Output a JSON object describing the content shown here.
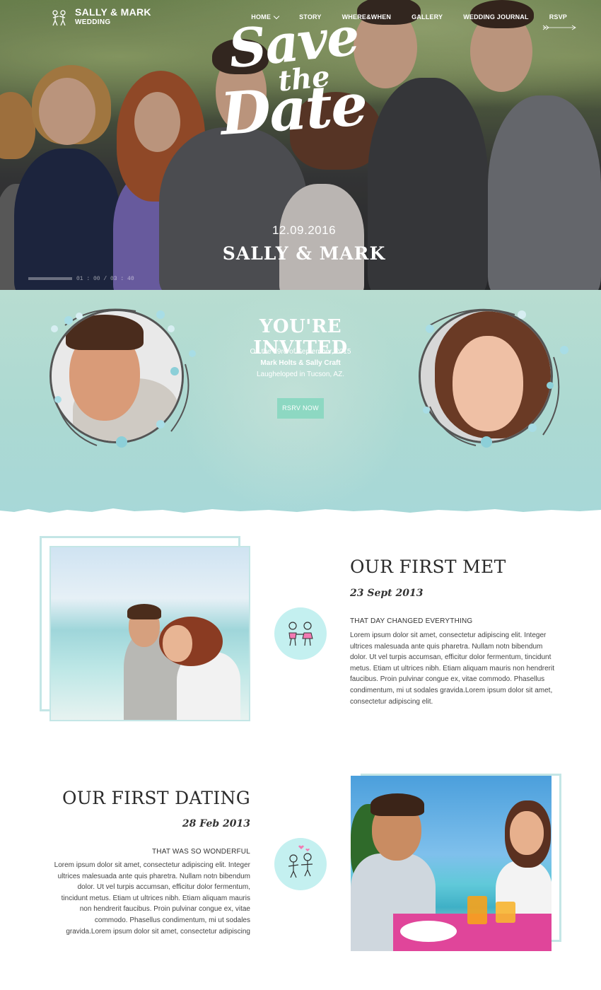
{
  "nav": {
    "brand_title": "SALLY & MARK",
    "brand_sub": "WEDDING",
    "items": [
      {
        "label": "HOME",
        "has_dropdown": true
      },
      {
        "label": "STORY"
      },
      {
        "label": "WHERE&WHEN"
      },
      {
        "label": "GALLERY"
      },
      {
        "label": "WEDDING JOURNAL"
      },
      {
        "label": "RSVP"
      }
    ]
  },
  "hero": {
    "script_line1": "Save",
    "script_line2": "the",
    "script_line3": "Date",
    "date": "12.09.2016",
    "names": "SALLY & MARK",
    "video_time": "01 : 00 / 03 : 40"
  },
  "invite": {
    "title": "YOU'RE INVITED",
    "line1": "On the 19rd of September, 2015",
    "line2": "Mark Holts & Sally Craft",
    "line3": "Laugheloped in Tucson, AZ.",
    "button": "RSRV NOW"
  },
  "story": [
    {
      "title": "OUR FIRST MET",
      "date": "23 Sept 2013",
      "subtitle": "THAT DAY CHANGED EVERYTHING",
      "body": "Lorem ipsum dolor sit amet, consectetur adipiscing elit. Integer ultrices malesuada ante quis pharetra. Nullam notn bibendum dolor. Ut vel turpis accumsan, efficitur dolor fermentum, tincidunt metus. Etiam ut ultrices nibh. Etiam aliquam mauris non hendrerit faucibus. Proin pulvinar congue ex, vitae commodo. Phasellus condimentum, mi ut sodales gravida.Lorem ipsum dolor sit amet, consectetur adipiscing elit.",
      "icon": "couple-holding-hands-icon"
    },
    {
      "title": "OUR FIRST DATING",
      "date": "28 Feb 2013",
      "subtitle": "THAT WAS SO WONDERFUL",
      "body": "Lorem ipsum dolor sit amet, consectetur adipiscing elit. Integer ultrices malesuada ante quis pharetra. Nullam notn bibendum dolor. Ut vel turpis accumsan, efficitur dolor fermentum, tincidunt metus. Etiam ut ultrices nibh. Etiam aliquam mauris non hendrerit faucibus. Proin pulvinar congue ex, vitae commodo. Phasellus condimentum, mi ut sodales gravida.Lorem ipsum dolor sit amet, consectetur adipiscing",
      "icon": "couple-with-hearts-icon"
    }
  ],
  "colors": {
    "mint_bg": "#b8ddd1",
    "button": "#8dd8c2",
    "frame": "#c4e6e6",
    "badge": "#c4f0f0"
  }
}
